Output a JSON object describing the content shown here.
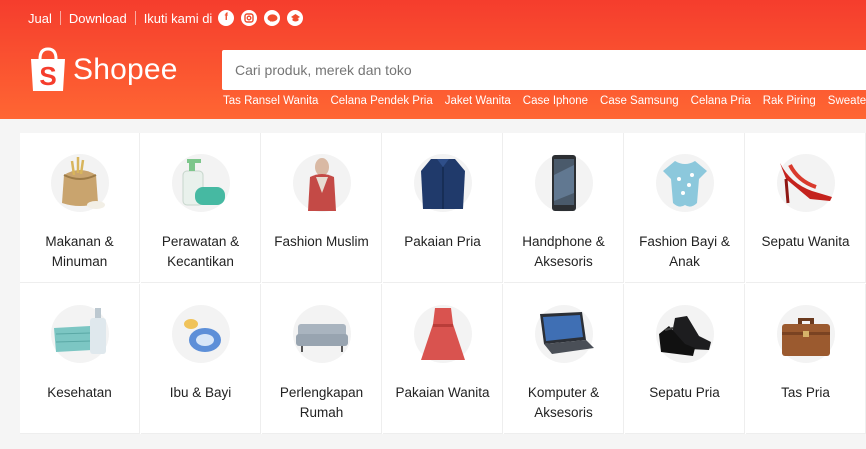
{
  "topbar": {
    "sell": "Jual",
    "download": "Download",
    "follow": "Ikuti kami di",
    "social_icons": [
      "facebook-icon",
      "instagram-icon",
      "line-icon",
      "playlist-icon"
    ]
  },
  "header": {
    "brand": "Shopee",
    "search_placeholder": "Cari produk, merek dan toko",
    "keywords": [
      "Tas Ransel Wanita",
      "Celana Pendek Pria",
      "Jaket Wanita",
      "Case Iphone",
      "Case Samsung",
      "Celana Pria",
      "Rak Piring",
      "Sweater"
    ],
    "colors": {
      "brand": "#f53d2d",
      "brand_light": "#ff6633"
    }
  },
  "categories": [
    {
      "label": "Makanan & Minuman",
      "icon": "rice-sack-icon"
    },
    {
      "label": "Perawatan & Kecantikan",
      "icon": "soap-bottle-icon"
    },
    {
      "label": "Fashion Muslim",
      "icon": "hijab-woman-icon"
    },
    {
      "label": "Pakaian Pria",
      "icon": "shirt-icon"
    },
    {
      "label": "Handphone & Aksesoris",
      "icon": "smartphone-icon"
    },
    {
      "label": "Fashion Bayi & Anak",
      "icon": "baby-bodysuit-icon"
    },
    {
      "label": "Sepatu Wanita",
      "icon": "high-heel-icon"
    },
    {
      "label": "Kesehatan",
      "icon": "mask-sanitizer-icon"
    },
    {
      "label": "Ibu & Bayi",
      "icon": "pacifier-icon"
    },
    {
      "label": "Perlengkapan Rumah",
      "icon": "sofa-icon"
    },
    {
      "label": "Pakaian Wanita",
      "icon": "dress-icon"
    },
    {
      "label": "Komputer & Aksesoris",
      "icon": "laptop-icon"
    },
    {
      "label": "Sepatu Pria",
      "icon": "leather-shoe-icon"
    },
    {
      "label": "Tas Pria",
      "icon": "briefcase-icon"
    }
  ]
}
